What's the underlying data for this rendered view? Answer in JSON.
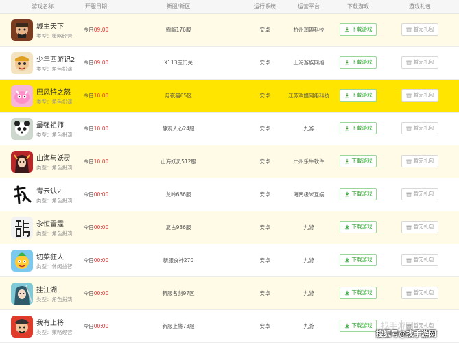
{
  "header": {
    "game_name": "游戏名称",
    "open_date": "开服日期",
    "server": "新服/新区",
    "os": "运行系统",
    "operator": "运营平台",
    "download": "下载游戏",
    "gift": "游戏礼包"
  },
  "labels": {
    "today": "今日",
    "download_button": "下载游戏",
    "gift_button": "暂无礼包"
  },
  "rows": [
    {
      "name": "城主天下",
      "type": "类型：策略经营",
      "time": "09:00",
      "server": "霸临176服",
      "os": "安卓",
      "operator": "杭州润趣科技",
      "icon": "warlord-icon"
    },
    {
      "name": "少年西游记2",
      "type": "类型：角色扮演",
      "time": "09:00",
      "server": "X113玉门关",
      "os": "安卓",
      "operator": "上海游族网络",
      "icon": "monkey-king-icon"
    },
    {
      "name": "巴风特之怒",
      "type": "类型：角色扮演",
      "time": "10:00",
      "server": "月夜猫65区",
      "os": "安卓",
      "operator": "江苏欢娱网络科技",
      "icon": "pink-creature-icon"
    },
    {
      "name": "最强祖师",
      "type": "类型：角色扮演",
      "time": "10:00",
      "server": "静观人心24服",
      "os": "安卓",
      "operator": "九游",
      "icon": "panda-master-icon"
    },
    {
      "name": "山海与妖灵",
      "type": "类型：角色扮演",
      "time": "10:00",
      "server": "山海妖灵512服",
      "os": "安卓",
      "operator": "广州乐牛软件",
      "icon": "demon-girl-icon"
    },
    {
      "name": "青云诀2",
      "type": "类型：角色扮演",
      "time": "00:00",
      "server": "龙吟686服",
      "os": "安卓",
      "operator": "海南极米互娱",
      "icon": "calligraphy-icon"
    },
    {
      "name": "永恒雷霆",
      "type": "类型：角色扮演",
      "time": "00:00",
      "server": "复古936服",
      "os": "安卓",
      "operator": "九游",
      "icon": "dragon-character-icon"
    },
    {
      "name": "切菜狂人",
      "type": "类型：休闲益智",
      "time": "00:00",
      "server": "新服食神270",
      "os": "安卓",
      "operator": "九游",
      "icon": "veggie-hero-icon"
    },
    {
      "name": "挂江湖",
      "type": "类型：角色扮演",
      "time": "00:00",
      "server": "新服名剑97区",
      "os": "安卓",
      "operator": "九游",
      "icon": "swordswoman-icon"
    },
    {
      "name": "我有上将",
      "type": "类型：策略经营",
      "time": "00:00",
      "server": "新服上将73服",
      "os": "安卓",
      "operator": "九游",
      "icon": "general-icon"
    }
  ],
  "watermark": {
    "text": "搜狐号@找手游网",
    "ghost": "找手游网"
  },
  "colors": {
    "highlight": "#ffe500",
    "alt_row": "#fffbe6",
    "time_red": "#ee3333",
    "download_green": "#2aa52a"
  }
}
